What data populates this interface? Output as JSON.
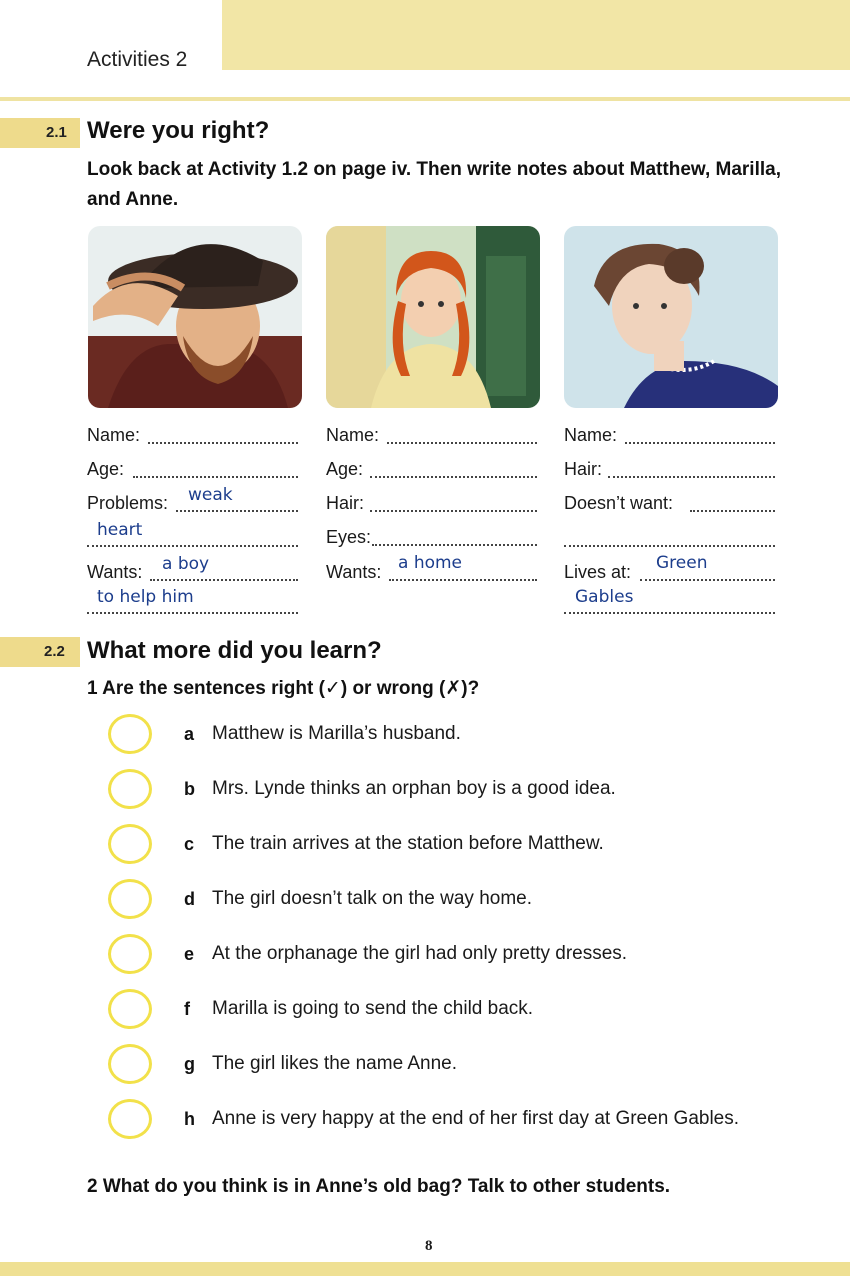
{
  "header": {
    "title": "Activities 2"
  },
  "s21": {
    "number": "2.1",
    "title": "Were you right?",
    "instruction": "Look back at Activity 1.2 on page iv. Then write notes about Matthew, Marilla, and Anne."
  },
  "col1": {
    "name_label": "Name:",
    "age_label": "Age:",
    "problems_label": "Problems:",
    "problems_hw1": "weak",
    "problems_hw2": "heart",
    "wants_label": "Wants:",
    "wants_hw1": "a boy",
    "wants_hw2": "to help him"
  },
  "col2": {
    "name_label": "Name:",
    "age_label": "Age:",
    "hair_label": "Hair:",
    "eyes_label": "Eyes:",
    "wants_label": "Wants:",
    "wants_hw1": "a home"
  },
  "col3": {
    "name_label": "Name:",
    "hair_label": "Hair:",
    "doesnt_want_label": "Doesn’t want:",
    "lives_label": "Lives at:",
    "lives_hw1": "Green",
    "lives_hw2": "Gables"
  },
  "s22": {
    "number": "2.2",
    "title": "What more did you learn?",
    "q1": "1  Are the sentences right (✓) or wrong (✗)?",
    "sentences": [
      {
        "letter": "a",
        "text": "Matthew is Marilla’s husband."
      },
      {
        "letter": "b",
        "text": "Mrs. Lynde thinks an orphan boy is a good idea."
      },
      {
        "letter": "c",
        "text": "The train arrives at the station before Matthew."
      },
      {
        "letter": "d",
        "text": "The girl doesn’t talk on the way home."
      },
      {
        "letter": "e",
        "text": "At the orphanage the girl had only pretty dresses."
      },
      {
        "letter": "f",
        "text": "Marilla is going to send the child back."
      },
      {
        "letter": "g",
        "text": "The girl likes the name Anne."
      },
      {
        "letter": "h",
        "text": "Anne is very happy at the end of her first day at Green Gables."
      }
    ],
    "q2": "2  What do you think is in Anne’s old bag? Talk to other students."
  },
  "page_number": "8",
  "colors": {
    "accent_yellow": "#f2e6a6",
    "tab_yellow": "#eedb8c",
    "handwriting_blue": "#1c3d8c",
    "circle_yellow": "#f2e14a"
  }
}
